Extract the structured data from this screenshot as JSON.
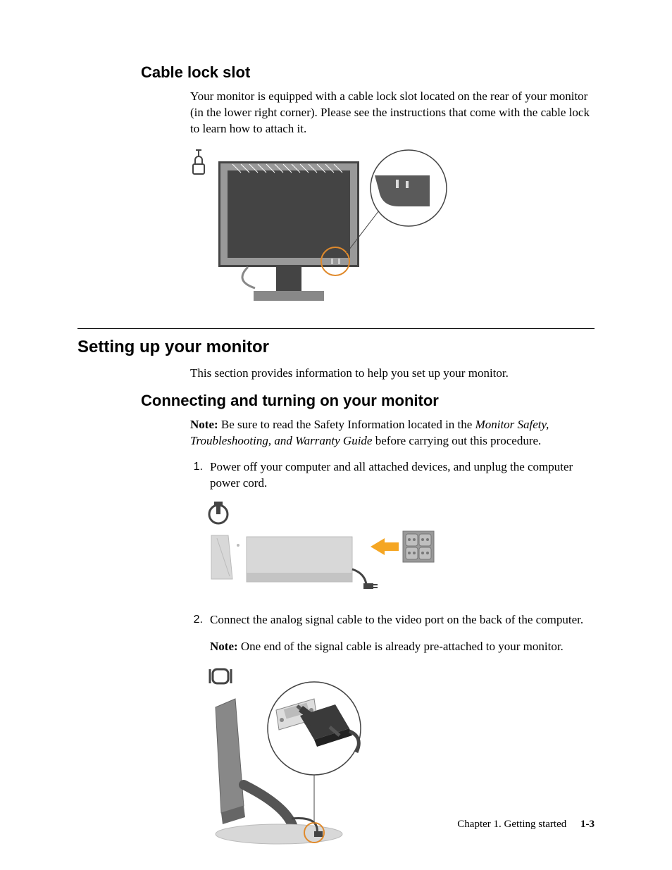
{
  "section1": {
    "heading": "Cable lock slot",
    "paragraph": "Your monitor is equipped with a cable lock slot located on the rear of your monitor (in the lower right corner). Please see the instructions that come with the cable lock to learn how to attach it."
  },
  "section2": {
    "heading": "Setting up your monitor",
    "intro": "This section provides information to help you set up your monitor."
  },
  "section3": {
    "heading": "Connecting and turning on your monitor",
    "note_label": "Note:",
    "note_before_italic": " Be sure to read the Safety Information located in the ",
    "note_italic": "Monitor Safety, Troubleshooting, and Warranty Guide",
    "note_after_italic": " before carrying out this procedure.",
    "steps": [
      {
        "num": "1.",
        "text": "Power off your computer and all attached devices, and unplug the computer power cord."
      },
      {
        "num": "2.",
        "text": "Connect the analog signal cable to the video port on the back of the computer."
      }
    ],
    "step2_note_label": "Note:",
    "step2_note_text": " One end of the signal cable is already pre-attached to your monitor."
  },
  "footer": {
    "chapter": "Chapter 1. Getting started",
    "page": "1-3"
  }
}
